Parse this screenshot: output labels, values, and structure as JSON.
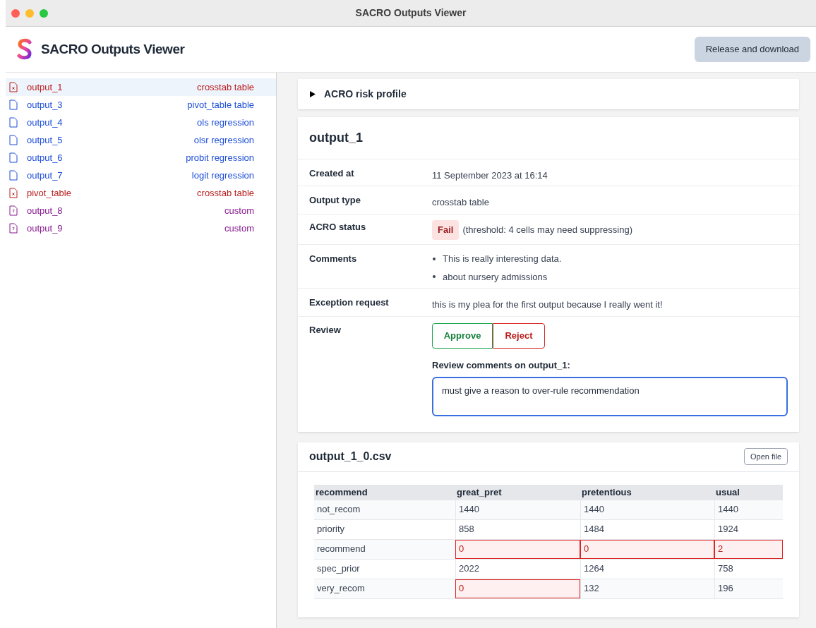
{
  "window": {
    "title": "SACRO Outputs Viewer"
  },
  "header": {
    "app_name": "SACRO Outputs Viewer",
    "release_button": "Release and download"
  },
  "sidebar": {
    "items": [
      {
        "name": "output_1",
        "type": "crosstab table",
        "kind": "flagged",
        "color": "#b91c1c",
        "selected": true
      },
      {
        "name": "output_3",
        "type": "pivot_table table",
        "kind": "plain",
        "color": "#1d4ed8",
        "selected": false
      },
      {
        "name": "output_4",
        "type": "ols regression",
        "kind": "plain",
        "color": "#1d4ed8",
        "selected": false
      },
      {
        "name": "output_5",
        "type": "olsr regression",
        "kind": "plain",
        "color": "#1d4ed8",
        "selected": false
      },
      {
        "name": "output_6",
        "type": "probit regression",
        "kind": "plain",
        "color": "#1d4ed8",
        "selected": false
      },
      {
        "name": "output_7",
        "type": "logit regression",
        "kind": "plain",
        "color": "#1d4ed8",
        "selected": false
      },
      {
        "name": "pivot_table",
        "type": "crosstab table",
        "kind": "flagged",
        "color": "#b91c1c",
        "selected": false
      },
      {
        "name": "output_8",
        "type": "custom",
        "kind": "custom",
        "color": "#86198f",
        "selected": false
      },
      {
        "name": "output_9",
        "type": "custom",
        "kind": "custom",
        "color": "#86198f",
        "selected": false
      }
    ]
  },
  "risk_profile": {
    "label": "ACRO risk profile",
    "expanded": false
  },
  "details": {
    "title": "output_1",
    "created": {
      "label": "Created at",
      "value": "11 September 2023 at 16:14"
    },
    "output_type": {
      "label": "Output type",
      "value": "crosstab table"
    },
    "status": {
      "label": "ACRO status",
      "badge": "Fail",
      "text": "(threshold: 4 cells may need suppressing)"
    },
    "comments": {
      "label": "Comments",
      "items": [
        "This is really interesting data.",
        "about nursery admissions"
      ]
    },
    "exception": {
      "label": "Exception request",
      "value": "this is my plea for the first output because I really went it!"
    },
    "review": {
      "label": "Review",
      "approve": "Approve",
      "reject": "Reject",
      "comments_label": "Review comments on output_1:",
      "comments_value": "must give a reason to over-rule recommendation"
    }
  },
  "file": {
    "name": "output_1_0.csv",
    "open_button": "Open file",
    "table": {
      "columns": [
        "recommend",
        "great_pret",
        "pretentious",
        "usual"
      ],
      "rows": [
        [
          {
            "text": "not_recom",
            "flagged": false
          },
          {
            "text": "1440",
            "flagged": false
          },
          {
            "text": "1440",
            "flagged": false
          },
          {
            "text": "1440",
            "flagged": false
          }
        ],
        [
          {
            "text": "priority",
            "flagged": false
          },
          {
            "text": "858",
            "flagged": false
          },
          {
            "text": "1484",
            "flagged": false
          },
          {
            "text": "1924",
            "flagged": false
          }
        ],
        [
          {
            "text": "recommend",
            "flagged": false
          },
          {
            "text": "0",
            "flagged": true
          },
          {
            "text": "0",
            "flagged": true
          },
          {
            "text": "2",
            "flagged": true
          }
        ],
        [
          {
            "text": "spec_prior",
            "flagged": false
          },
          {
            "text": "2022",
            "flagged": false
          },
          {
            "text": "1264",
            "flagged": false
          },
          {
            "text": "758",
            "flagged": false
          }
        ],
        [
          {
            "text": "very_recom",
            "flagged": false
          },
          {
            "text": "0",
            "flagged": true
          },
          {
            "text": "132",
            "flagged": false
          },
          {
            "text": "196",
            "flagged": false
          }
        ]
      ]
    }
  }
}
